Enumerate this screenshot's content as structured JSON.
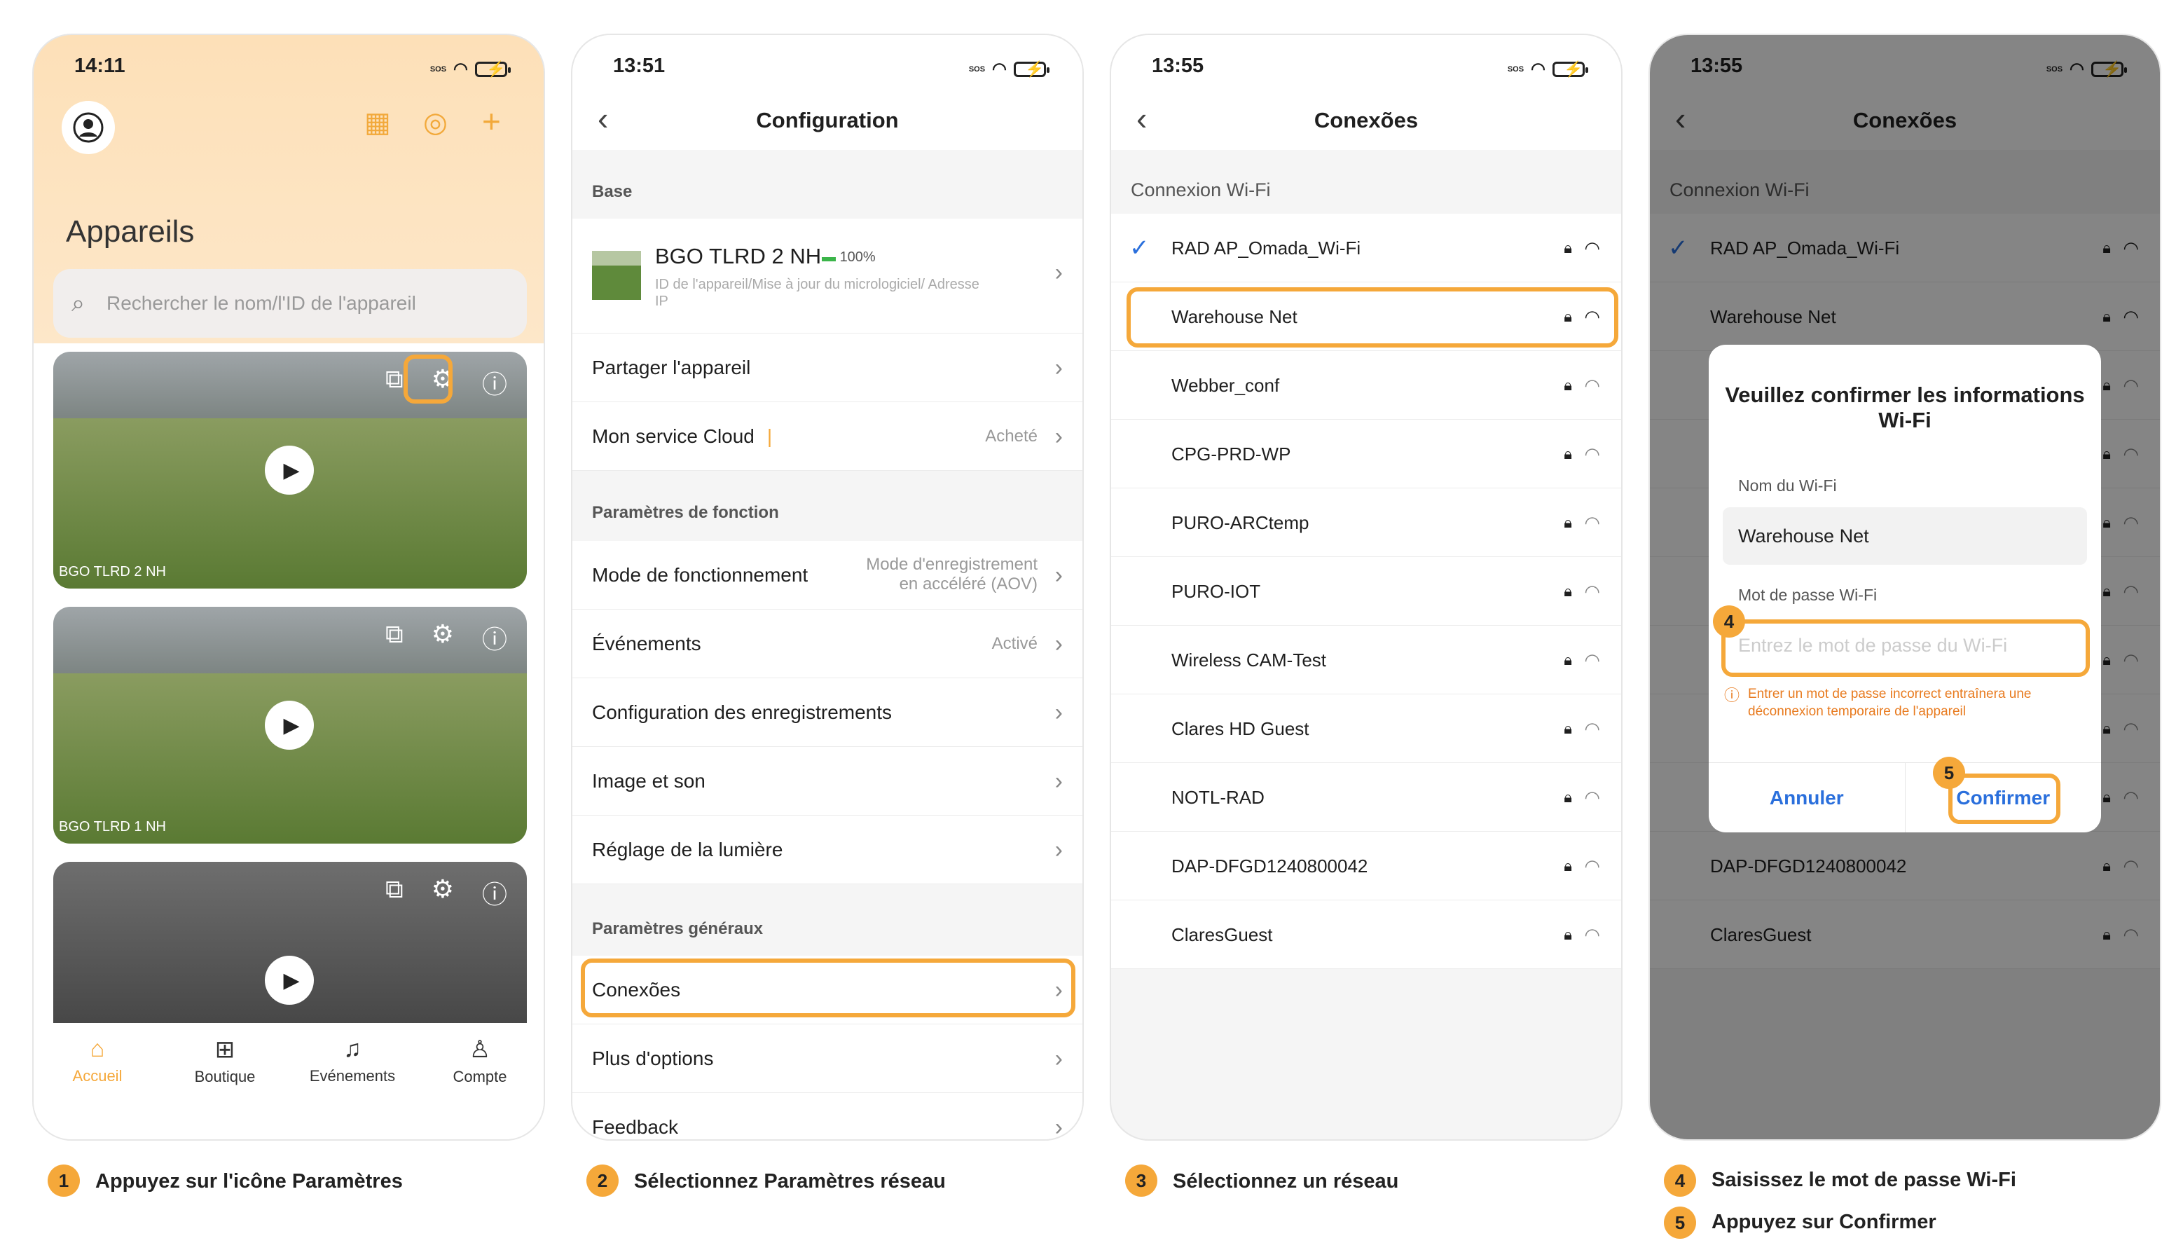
{
  "screen1": {
    "time": "14:11",
    "title": "Appareils",
    "search_placeholder": "Rechercher le nom/l'ID de l'appareil",
    "cameras": [
      {
        "name": "BGO TLRD 2 NH"
      },
      {
        "name": "BGO TLRD 1 NH"
      },
      {
        "name": ""
      }
    ],
    "tabs": [
      "Accueil",
      "Boutique",
      "Evénements",
      "Compte"
    ]
  },
  "screen2": {
    "time": "13:51",
    "title": "Configuration",
    "section_base": "Base",
    "device_name": "BGO TLRD 2 NH",
    "device_battery": "100%",
    "device_sub": "ID de l'appareil/Mise à jour du micrologiciel/ Adresse IP",
    "share": "Partager l'appareil",
    "cloud": "Mon service Cloud",
    "cloud_value": "Acheté",
    "section_function": "Paramètres de fonction",
    "mode": "Mode de fonctionnement",
    "mode_value_1": "Mode d'enregistrement",
    "mode_value_2": "en accéléré (AOV)",
    "events": "Événements",
    "events_value": "Activé",
    "rec_config": "Configuration des enregistrements",
    "image_sound": "Image et son",
    "light": "Réglage de la lumière",
    "section_general": "Paramètres généraux",
    "connections": "Conexões",
    "more": "Plus d'options",
    "feedback": "Feedback"
  },
  "screen3": {
    "time": "13:55",
    "title": "Conexões",
    "section": "Connexion Wi-Fi",
    "networks": [
      "RAD AP_Omada_Wi-Fi",
      "Warehouse Net",
      "Webber_conf",
      "CPG-PRD-WP",
      "PURO-ARCtemp",
      "PURO-IOT",
      "Wireless CAM-Test",
      "Clares HD Guest",
      "NOTL-RAD",
      "DAP-DFGD1240800042",
      "ClaresGuest"
    ]
  },
  "screen4": {
    "time": "13:55",
    "title": "Conexões",
    "section": "Connexion Wi-Fi",
    "dialog_title": "Veuillez confirmer les informations Wi-Fi",
    "ssid_label": "Nom du Wi-Fi",
    "ssid_value": "Warehouse Net",
    "pw_label": "Mot de passe Wi-Fi",
    "pw_placeholder": "Entrez le mot de passe du Wi-Fi",
    "warning": "Entrer un mot de passe incorrect entraînera une déconnexion temporaire de l'appareil",
    "cancel": "Annuler",
    "confirm": "Confirmer"
  },
  "steps": [
    {
      "n": "1",
      "text": "Appuyez sur l'icône Paramètres"
    },
    {
      "n": "2",
      "text": "Sélectionnez Paramètres réseau"
    },
    {
      "n": "3",
      "text": "Sélectionnez un réseau"
    },
    {
      "n": "4",
      "text": "Saisissez le mot de passe Wi-Fi"
    },
    {
      "n": "5",
      "text": "Appuyez sur Confirmer"
    }
  ],
  "colors": {
    "accent": "#f5a83a",
    "link": "#2a6fdc"
  }
}
